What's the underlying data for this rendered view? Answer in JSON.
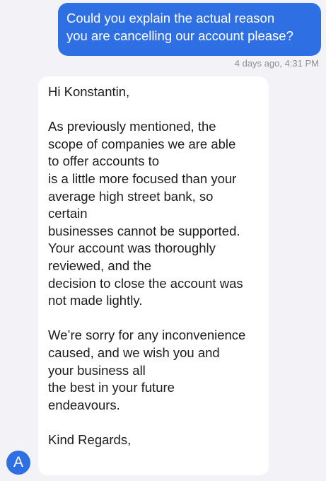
{
  "conversation": {
    "outgoing_message": {
      "text": "Could you explain the actual reason\nyou are cancelling our account please?",
      "timestamp": "4 days ago, 4:31 PM"
    },
    "incoming_message": {
      "text": "Hi Konstantin,\n\nAs previously mentioned, the\nscope of companies we are able\nto offer accounts to\nis a little more focused than your\naverage high street bank, so\ncertain\nbusinesses cannot be supported.\nYour account was thoroughly\nreviewed, and the\ndecision to close the account was\nnot made lightly.\n\nWe’re sorry for any inconvenience\ncaused, and we wish you and\nyour business all\nthe best in your future\nendeavours.\n\nKind Regards,"
    },
    "agent_avatar": {
      "initial": "A"
    }
  },
  "colors": {
    "outgoing_bubble": "#2f6fe4",
    "incoming_bubble": "#ffffff",
    "background": "#f2f2f7",
    "timestamp": "#8e8e93"
  }
}
